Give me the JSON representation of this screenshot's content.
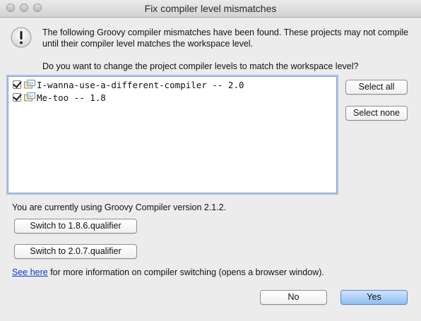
{
  "window": {
    "title": "Fix compiler level mismatches"
  },
  "message": {
    "text": "The following Groovy compiler mismatches have been found. These projects may not compile until their compiler level matches the workspace level.",
    "question": "Do you want to change the project compiler levels to match the workspace level?"
  },
  "projects": [
    {
      "label": "I-wanna-use-a-different-compiler -- 2.0",
      "checked": true
    },
    {
      "label": "Me-too -- 1.8",
      "checked": true
    }
  ],
  "side_buttons": {
    "select_all": "Select all",
    "select_none": "Select none"
  },
  "status": {
    "text": "You are currently using Groovy Compiler version 2.1.2."
  },
  "switch_buttons": {
    "switch_a": "Switch to 1.8.6.qualifier",
    "switch_b": "Switch to 2.0.7.qualifier"
  },
  "info": {
    "link_text": "See here",
    "text": " for more information on compiler switching (opens a browser window)."
  },
  "footer": {
    "no": "No",
    "yes": "Yes"
  },
  "colors": {
    "link": "#0a3ad8",
    "default_button": "#8fbef4",
    "list_focus": "#a8c3e8"
  }
}
